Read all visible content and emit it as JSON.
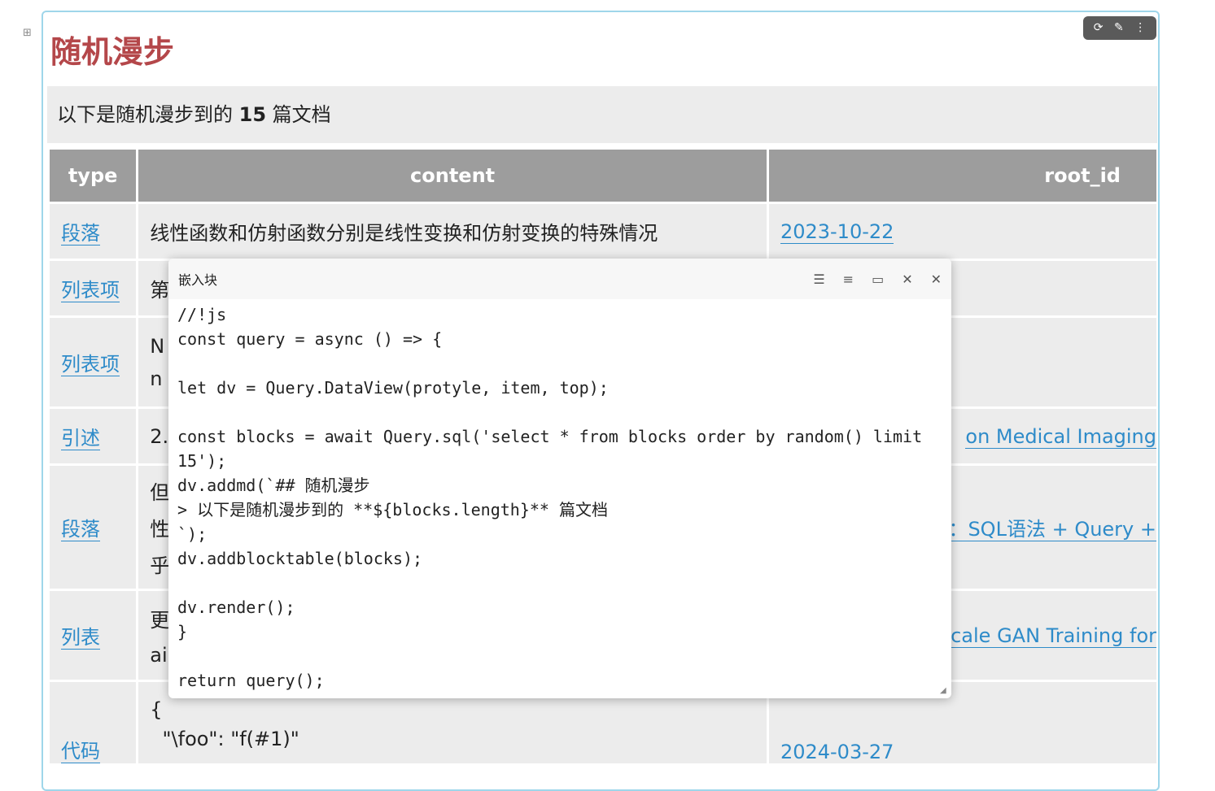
{
  "block_tools": {
    "refresh": "⟳",
    "edit": "✎",
    "more": "⋮"
  },
  "title": "随机漫步",
  "quote": {
    "prefix": "以下是随机漫步到的 ",
    "count": "15",
    "suffix": " 篇文档"
  },
  "table": {
    "headers": [
      "type",
      "content",
      "root_id"
    ],
    "rows": [
      {
        "type": "段落",
        "content": "线性函数和仿射函数分别是线性变换和仿射变换的特殊情况",
        "root": "2023-10-22"
      },
      {
        "type": "列表项",
        "content": "第",
        "root": ""
      },
      {
        "type": "列表项",
        "content": "N",
        "content2": "n",
        "root": ""
      },
      {
        "type": "引述",
        "content": "2.",
        "root": "on Medical Imaging"
      },
      {
        "type": "段落",
        "content": "但",
        "content2": "性",
        "content3": "乎",
        "root": "：SQL语法 + Query +"
      },
      {
        "type": "列表",
        "content": "更",
        "content2": "ai",
        "root": "cale GAN Training for"
      },
      {
        "type": "代码",
        "content": "{",
        "content2": "  \"\\foo\": \"f(#1)\"",
        "root": "2024-03-27"
      }
    ]
  },
  "popup": {
    "title": "嵌入块",
    "code": "//!js\nconst query = async () => {\n\nlet dv = Query.DataView(protyle, item, top);\n\nconst blocks = await Query.sql('select * from blocks order by random() limit 15');\ndv.addmd(`## 随机漫步\n> 以下是随机漫步到的 **${blocks.length}** 篇文档\n`);\ndv.addblocktable(blocks);\n\ndv.render();\n}\n\nreturn query();"
  },
  "icons": {
    "gutter": "gutter-icon",
    "popup_actions": [
      "collapse-icon",
      "expand-icon",
      "image-icon",
      "pin-icon",
      "close-icon"
    ]
  }
}
